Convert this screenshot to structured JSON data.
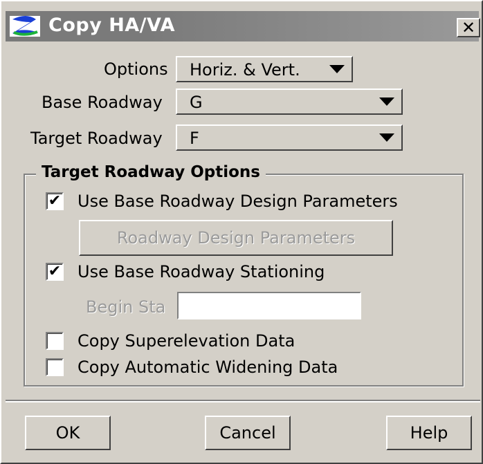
{
  "window": {
    "title": "Copy HA/VA",
    "close_glyph": "✕",
    "icon": "app-logo-icon"
  },
  "fields": {
    "options_label": "Options",
    "options_value": "Horiz. & Vert.",
    "base_roadway_label": "Base Roadway",
    "base_roadway_value": "G",
    "target_roadway_label": "Target Roadway",
    "target_roadway_value": "F"
  },
  "target_options": {
    "title": "Target Roadway Options",
    "use_base_design_params": {
      "label": "Use Base Roadway Design Parameters",
      "checked": true
    },
    "design_params_button": "Roadway Design Parameters",
    "use_base_stationing": {
      "label": "Use Base Roadway Stationing",
      "checked": true
    },
    "begin_sta_label": "Begin Sta",
    "begin_sta_value": "",
    "copy_superelevation": {
      "label": "Copy Superelevation Data",
      "checked": false
    },
    "copy_auto_widening": {
      "label": "Copy Automatic Widening Data",
      "checked": false
    }
  },
  "buttons": {
    "ok": "OK",
    "cancel": "Cancel",
    "help": "Help"
  },
  "colors": {
    "face": "#d4d0c8",
    "titlebar": "#7a7a7a",
    "disabled_text": "#9a9a9a"
  }
}
